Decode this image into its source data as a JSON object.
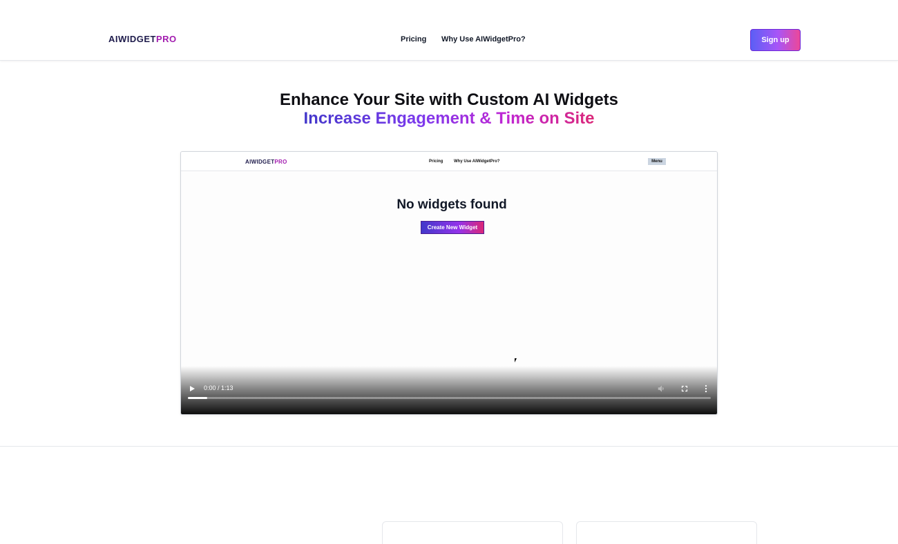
{
  "header": {
    "logo_main": "AIWIDGET",
    "logo_accent": "PRO",
    "nav": [
      "Pricing",
      "Why Use AIWidgetPro?"
    ],
    "signup_label": "Sign up"
  },
  "hero": {
    "title": "Enhance Your Site with Custom AI Widgets",
    "subtitle": "Increase Engagement & Time on Site"
  },
  "video": {
    "inner_logo_main": "AIWIDGET",
    "inner_logo_accent": "PRO",
    "inner_nav": [
      "Pricing",
      "Why Use AIWidgetPro?"
    ],
    "inner_menu_label": "Menu",
    "inner_title": "No widgets found",
    "inner_button_label": "Create New Widget",
    "time_display": "0:00 / 1:13",
    "progress_fraction": 0.037
  },
  "colors": {
    "brand_dark": "#1e1b4b",
    "brand_accent": "#a21caf",
    "gradient_start": "#4338ca",
    "gradient_end": "#db2777"
  },
  "icons": [
    "play-icon",
    "volume-icon",
    "fullscreen-icon",
    "more-vert-icon"
  ]
}
